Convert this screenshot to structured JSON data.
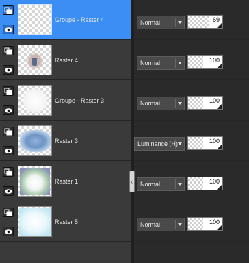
{
  "layers": [
    {
      "name": "Groupe - Raster 4",
      "blend": "Normal",
      "opacity": "69",
      "opacity_pct": 69,
      "selected": true,
      "thumb": "empty"
    },
    {
      "name": "Raster 4",
      "blend": "Normal",
      "opacity": "100",
      "opacity_pct": 100,
      "selected": false,
      "thumb": "figure"
    },
    {
      "name": "Groupe - Raster 3",
      "blend": "Normal",
      "opacity": "100",
      "opacity_pct": 100,
      "selected": false,
      "thumb": "white-blur"
    },
    {
      "name": "Raster 3",
      "blend": "Luminance (H)",
      "opacity": "100",
      "opacity_pct": 100,
      "selected": false,
      "thumb": "blue-cloud"
    },
    {
      "name": "Raster 1",
      "blend": "Normal",
      "opacity": "100",
      "opacity_pct": 100,
      "selected": false,
      "thumb": "green-frame"
    },
    {
      "name": "Raster 5",
      "blend": "Normal",
      "opacity": "100",
      "opacity_pct": 100,
      "selected": false,
      "thumb": "light-blue"
    }
  ],
  "colors": {
    "selection": "#3b8ff4",
    "panel": "#3a3a3a",
    "background": "#2a2a2a"
  },
  "icons": {
    "link": "layer-link-icon",
    "visibility": "eye-icon",
    "dropdown": "chevron-down-icon",
    "collapse": "chevron-left-icon"
  }
}
